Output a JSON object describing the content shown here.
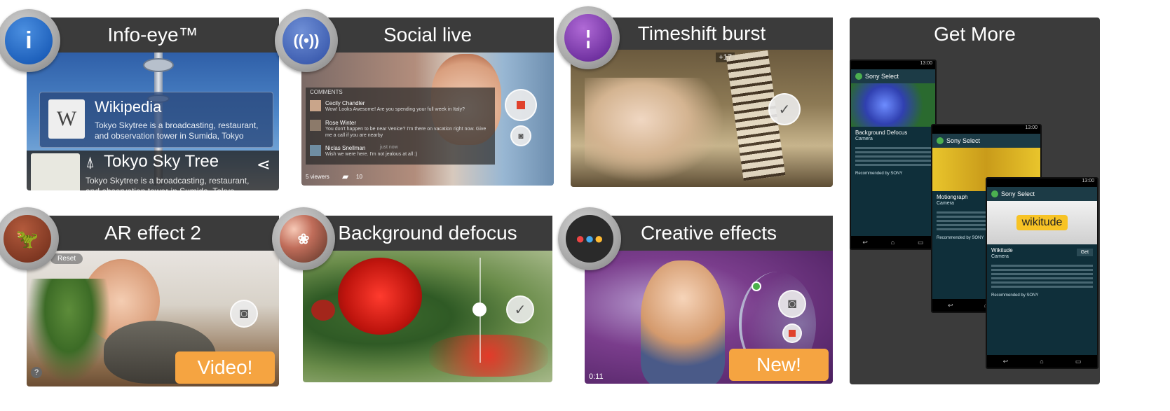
{
  "tiles": {
    "info_eye": {
      "title": "Info-eye™",
      "card_title": "Wikipedia",
      "card_text": "Tokyo Skytree is a broadcasting, restaurant, and observation tower in Sumida, Tokyo",
      "place_title": "Tokyo Sky Tree",
      "place_text": "Tokyo Skytree is a broadcasting, restaurant, and observation tower in Sumida, Tokyo, Japan",
      "icon": "info-icon"
    },
    "social_live": {
      "title": "Social live",
      "comments_label": "COMMENTS",
      "comments": [
        {
          "name": "Cecily Chandler",
          "text": "Wow! Looks Awesome! Are you spending your full week in Italy?"
        },
        {
          "name": "Rose Winter",
          "text": "You don't happen to be near Venice? I'm there on vacation right now. Give me a call if you are nearby"
        },
        {
          "name": "Niclas Snellman",
          "time": "just now",
          "text": "Wish we were here. I'm not jealous at all :)"
        }
      ],
      "viewers": "5 viewers",
      "likes": "10",
      "icon": "broadcast-icon"
    },
    "timeshift_burst": {
      "title": "Timeshift burst",
      "counter": "+17",
      "icon": "clock-icon"
    },
    "ar_effect": {
      "title": "AR effect 2",
      "reset_label": "Reset",
      "pill": "Video!",
      "icon": "dinosaur-icon"
    },
    "background_defocus": {
      "title": "Background defocus",
      "icon": "bokeh-icon"
    },
    "creative_effects": {
      "title": "Creative effects",
      "timer": "0:11",
      "pill": "New!",
      "icon": "palette-icon"
    }
  },
  "get_more": {
    "title": "Get More",
    "phones": [
      {
        "time": "13:00",
        "app": "Sony Select",
        "item": "Background Defocus",
        "category": "Camera",
        "recommended": "Recommended by SONY"
      },
      {
        "time": "13:00",
        "app": "Sony Select",
        "item": "Motiongraph",
        "category": "Camera",
        "recommended": "Recommended by SONY"
      },
      {
        "time": "13:00",
        "app": "Sony Select",
        "logo": "wikitude",
        "item": "Wikitude",
        "category": "Camera",
        "get": "Get",
        "recommended": "Recommended by SONY"
      }
    ]
  }
}
